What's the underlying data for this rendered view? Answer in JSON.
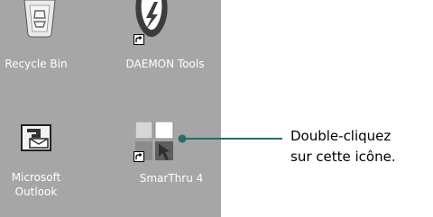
{
  "desktop": {
    "background_color": "#a6a6a6",
    "icons": [
      {
        "label": "Recycle Bin",
        "icon": "recycle-bin-icon"
      },
      {
        "label": "DAEMON Tools",
        "icon": "daemon-tools-icon",
        "shortcut": true
      },
      {
        "label_line1": "Microsoft",
        "label_line2": "Outlook",
        "icon": "outlook-icon"
      },
      {
        "label": "SmarThru 4",
        "icon": "smarthru-icon",
        "shortcut": true
      }
    ]
  },
  "callout": {
    "line1": "Double-cliquez",
    "line2": "sur cette icône.",
    "line_color": "#2a6b6b"
  }
}
